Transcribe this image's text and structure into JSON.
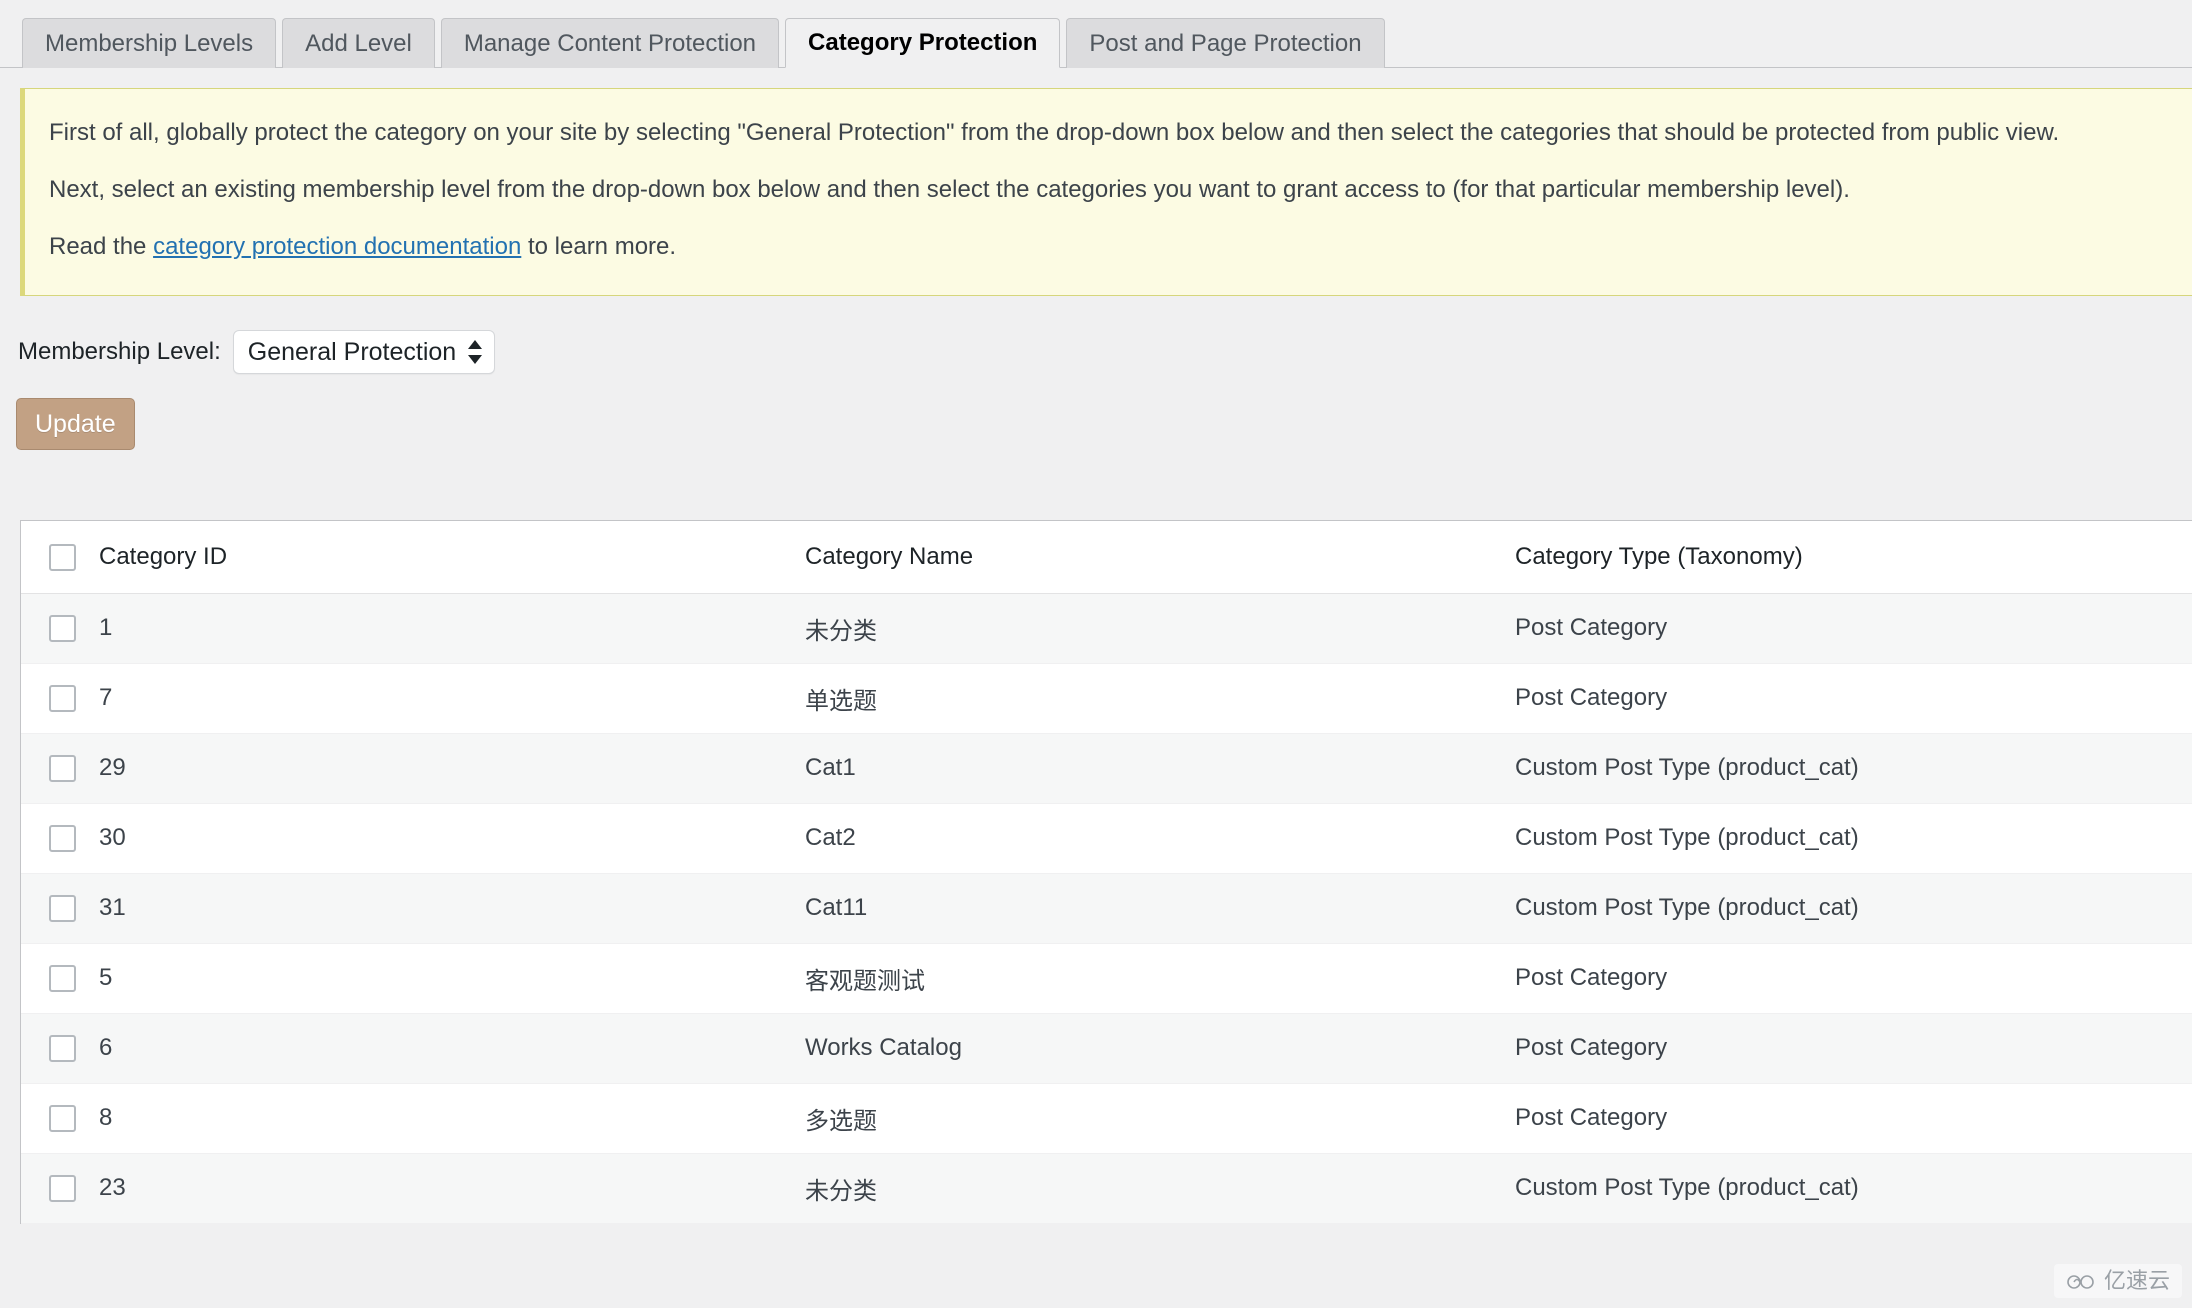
{
  "tabs": [
    {
      "label": "Membership Levels",
      "active": false
    },
    {
      "label": "Add Level",
      "active": false
    },
    {
      "label": "Manage Content Protection",
      "active": false
    },
    {
      "label": "Category Protection",
      "active": true
    },
    {
      "label": "Post and Page Protection",
      "active": false
    }
  ],
  "notice": {
    "line1": "First of all, globally protect the category on your site by selecting \"General Protection\" from the drop-down box below and then select the categories that should be protected from public view.",
    "line2": "Next, select an existing membership level from the drop-down box below and then select the categories you want to grant access to (for that particular membership level).",
    "line3_prefix": "Read the ",
    "line3_link": "category protection documentation",
    "line3_suffix": " to learn more."
  },
  "controls": {
    "level_label": "Membership Level:",
    "level_selected": "General Protection",
    "update_label": "Update"
  },
  "table": {
    "headers": {
      "id": "Category ID",
      "name": "Category Name",
      "type": "Category Type (Taxonomy)"
    },
    "rows": [
      {
        "id": "1",
        "name": "未分类",
        "type": "Post Category"
      },
      {
        "id": "7",
        "name": "单选题",
        "type": "Post Category"
      },
      {
        "id": "29",
        "name": "Cat1",
        "type": "Custom Post Type (product_cat)"
      },
      {
        "id": "30",
        "name": "Cat2",
        "type": "Custom Post Type (product_cat)"
      },
      {
        "id": "31",
        "name": "Cat11",
        "type": "Custom Post Type (product_cat)"
      },
      {
        "id": "5",
        "name": "客观题测试",
        "type": "Post Category"
      },
      {
        "id": "6",
        "name": "Works Catalog",
        "type": "Post Category"
      },
      {
        "id": "8",
        "name": "多选题",
        "type": "Post Category"
      },
      {
        "id": "23",
        "name": "未分类",
        "type": "Custom Post Type (product_cat)"
      }
    ]
  },
  "watermark": {
    "text": "亿速云"
  },
  "colors": {
    "accent_link": "#2271b1",
    "notice_bg": "#fcfbe3",
    "notice_border": "#d6d67c",
    "update_btn": "#c2a184",
    "tab_inactive": "#dcdcde",
    "page_bg": "#f0f0f1"
  }
}
